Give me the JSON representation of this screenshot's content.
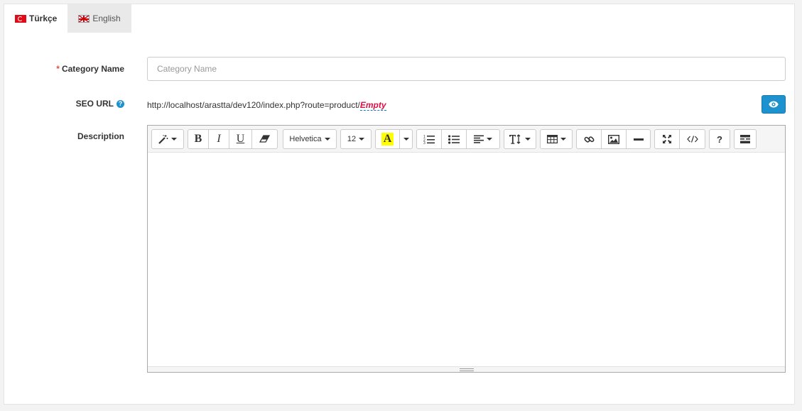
{
  "tabs": [
    {
      "label": "Türkçe",
      "flag": "flag-tr-icon",
      "active": true
    },
    {
      "label": "English",
      "flag": "flag-gb-icon",
      "active": false
    }
  ],
  "form": {
    "category_name": {
      "required_mark": "*",
      "label": "Category Name",
      "value": "",
      "placeholder": "Category Name"
    },
    "seo_url": {
      "label": "SEO URL",
      "help_icon": "question-circle-icon",
      "url_prefix": "http://localhost/arastta/dev120/index.php?route=product/",
      "editable_value": "Empty",
      "preview_icon": "eye-icon"
    },
    "description": {
      "label": "Description"
    }
  },
  "editor": {
    "font_family": "Helvetica",
    "font_size": "12",
    "color_letter": "A",
    "help_label": "?"
  },
  "colors": {
    "accent": "#1e91cf",
    "required": "#e3503e",
    "empty_link": "#dd1144",
    "highlight": "#ffff00"
  }
}
